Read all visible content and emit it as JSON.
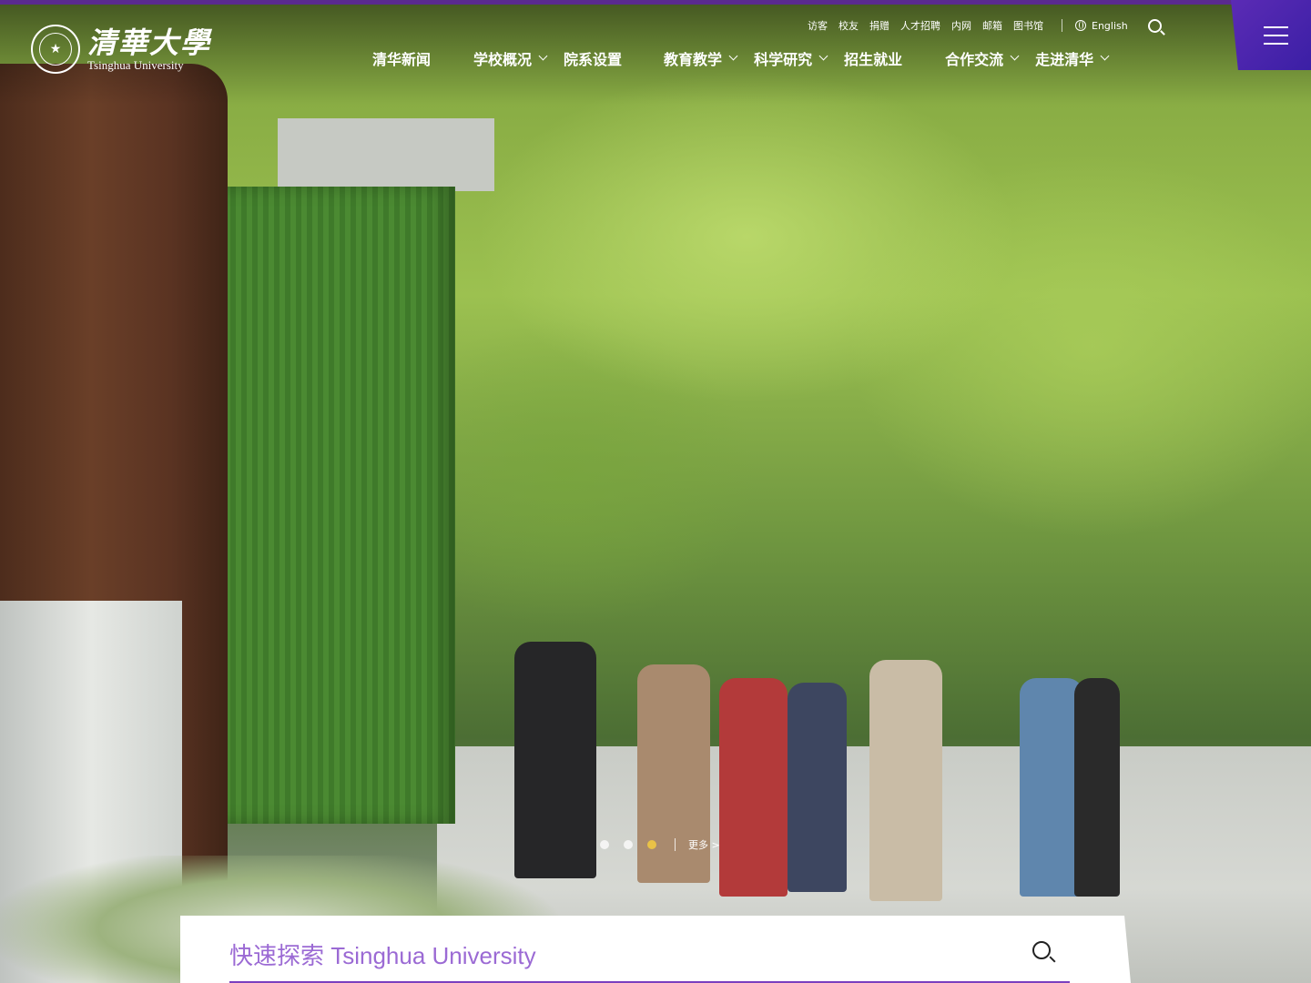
{
  "header": {
    "logo_cn": "清華大學",
    "logo_en": "Tsinghua University"
  },
  "utility_links": [
    "访客",
    "校友",
    "捐赠",
    "人才招聘",
    "内网",
    "邮箱",
    "图书馆"
  ],
  "language": "English",
  "nav": [
    {
      "label": "清华新闻",
      "dropdown": false
    },
    {
      "label": "学校概况",
      "dropdown": true
    },
    {
      "label": "院系设置",
      "dropdown": false
    },
    {
      "label": "教育教学",
      "dropdown": true
    },
    {
      "label": "科学研究",
      "dropdown": true
    },
    {
      "label": "招生就业",
      "dropdown": false
    },
    {
      "label": "合作交流",
      "dropdown": true
    },
    {
      "label": "走进清华",
      "dropdown": true
    }
  ],
  "carousel": {
    "slides": 3,
    "active_index": 2,
    "more_label": "更多 >"
  },
  "quick_search": {
    "text": "快速探索 Tsinghua University"
  },
  "colors": {
    "brand_purple": "#5a2a8f",
    "menu_button": "#4a25ad",
    "active_dot": "#e9c247",
    "quick_text": "#9b6ad4"
  }
}
